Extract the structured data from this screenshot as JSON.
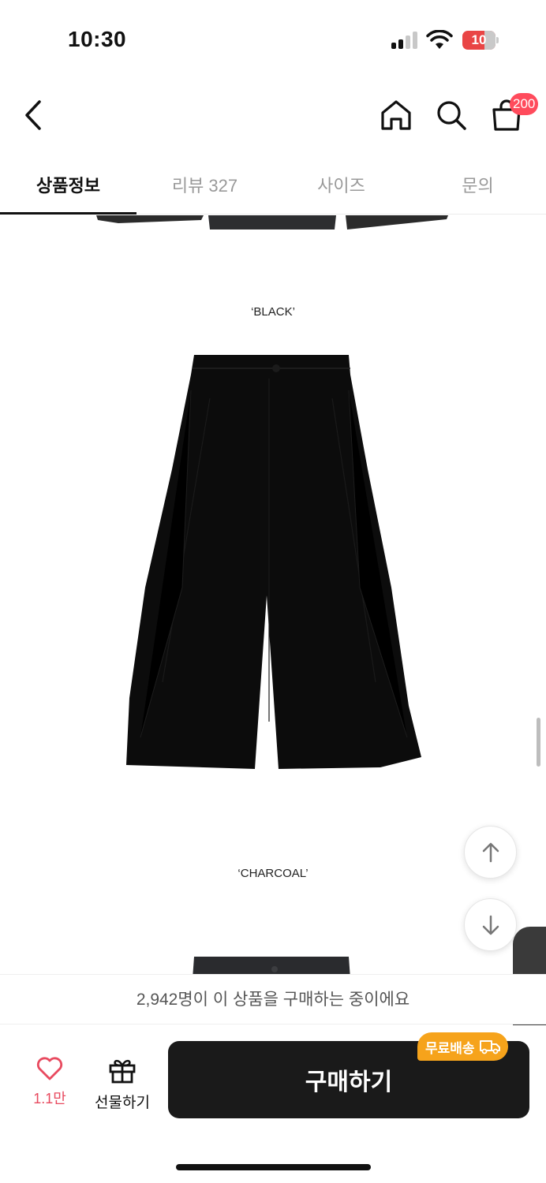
{
  "status_bar": {
    "time": "10:30",
    "battery": "10"
  },
  "nav": {
    "cart_count": "200"
  },
  "tabs": [
    {
      "label": "상품정보",
      "active": true
    },
    {
      "label": "리뷰 327",
      "active": false
    },
    {
      "label": "사이즈",
      "active": false
    },
    {
      "label": "문의",
      "active": false
    }
  ],
  "content": {
    "captions": [
      "‘BLACK’",
      "‘CHARCOAL’"
    ]
  },
  "buyers_banner": "2,942명이 이 상품을 구매하는 중이에요",
  "bottom_bar": {
    "like_count": "1.1만",
    "gift_label": "선물하기",
    "buy_label": "구매하기",
    "free_shipping": "무료배송"
  },
  "colors": {
    "accent_red": "#ff4b5c",
    "like_red": "#e84a5f",
    "badge_orange": "#f6a31b",
    "buy_button": "#1a1a1a"
  }
}
